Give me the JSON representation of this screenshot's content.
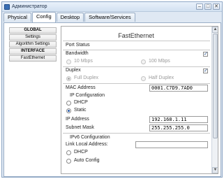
{
  "window": {
    "title": "Администратор",
    "buttons": [
      "–",
      "□",
      "✕"
    ]
  },
  "tabs": [
    "Physical",
    "Config",
    "Desktop",
    "Software/Services"
  ],
  "active_tab": "Config",
  "sidebar": {
    "items": [
      {
        "label": "GLOBAL",
        "header": true
      },
      {
        "label": "Settings",
        "header": false
      },
      {
        "label": "Algorithm Settings",
        "header": false
      },
      {
        "label": "INTERFACE",
        "header": true
      },
      {
        "label": "FastEthernet",
        "header": false
      }
    ]
  },
  "panel": {
    "title": "FastEthernet",
    "port_status_label": "Port Status",
    "bandwidth": {
      "label": "Bandwidth",
      "auto_checked": true,
      "opt_10": "10 Mbps",
      "opt_100": "100 Mbps"
    },
    "duplex": {
      "label": "Duplex",
      "auto_checked": true,
      "opt_full": "Full Duplex",
      "opt_half": "Half Duplex"
    },
    "mac": {
      "label": "MAC Address",
      "value": "0001.C7D9.7AD0"
    },
    "ip_config": {
      "section_label": "IP Configuration",
      "dhcp": "DHCP",
      "static": "Static",
      "selected": "Static",
      "ip_label": "IP Address",
      "ip_value": "192.168.1.11",
      "mask_label": "Subnet Mask",
      "mask_value": "255.255.255.0"
    },
    "ipv6": {
      "section_label": "IPv6 Configuration",
      "link_local_label": "Link Local Address:",
      "link_local_value": "",
      "dhcp": "DHCP",
      "auto": "Auto Config"
    }
  },
  "checkmark": "✓",
  "scroll": {
    "up": "▲",
    "down": "▼"
  }
}
